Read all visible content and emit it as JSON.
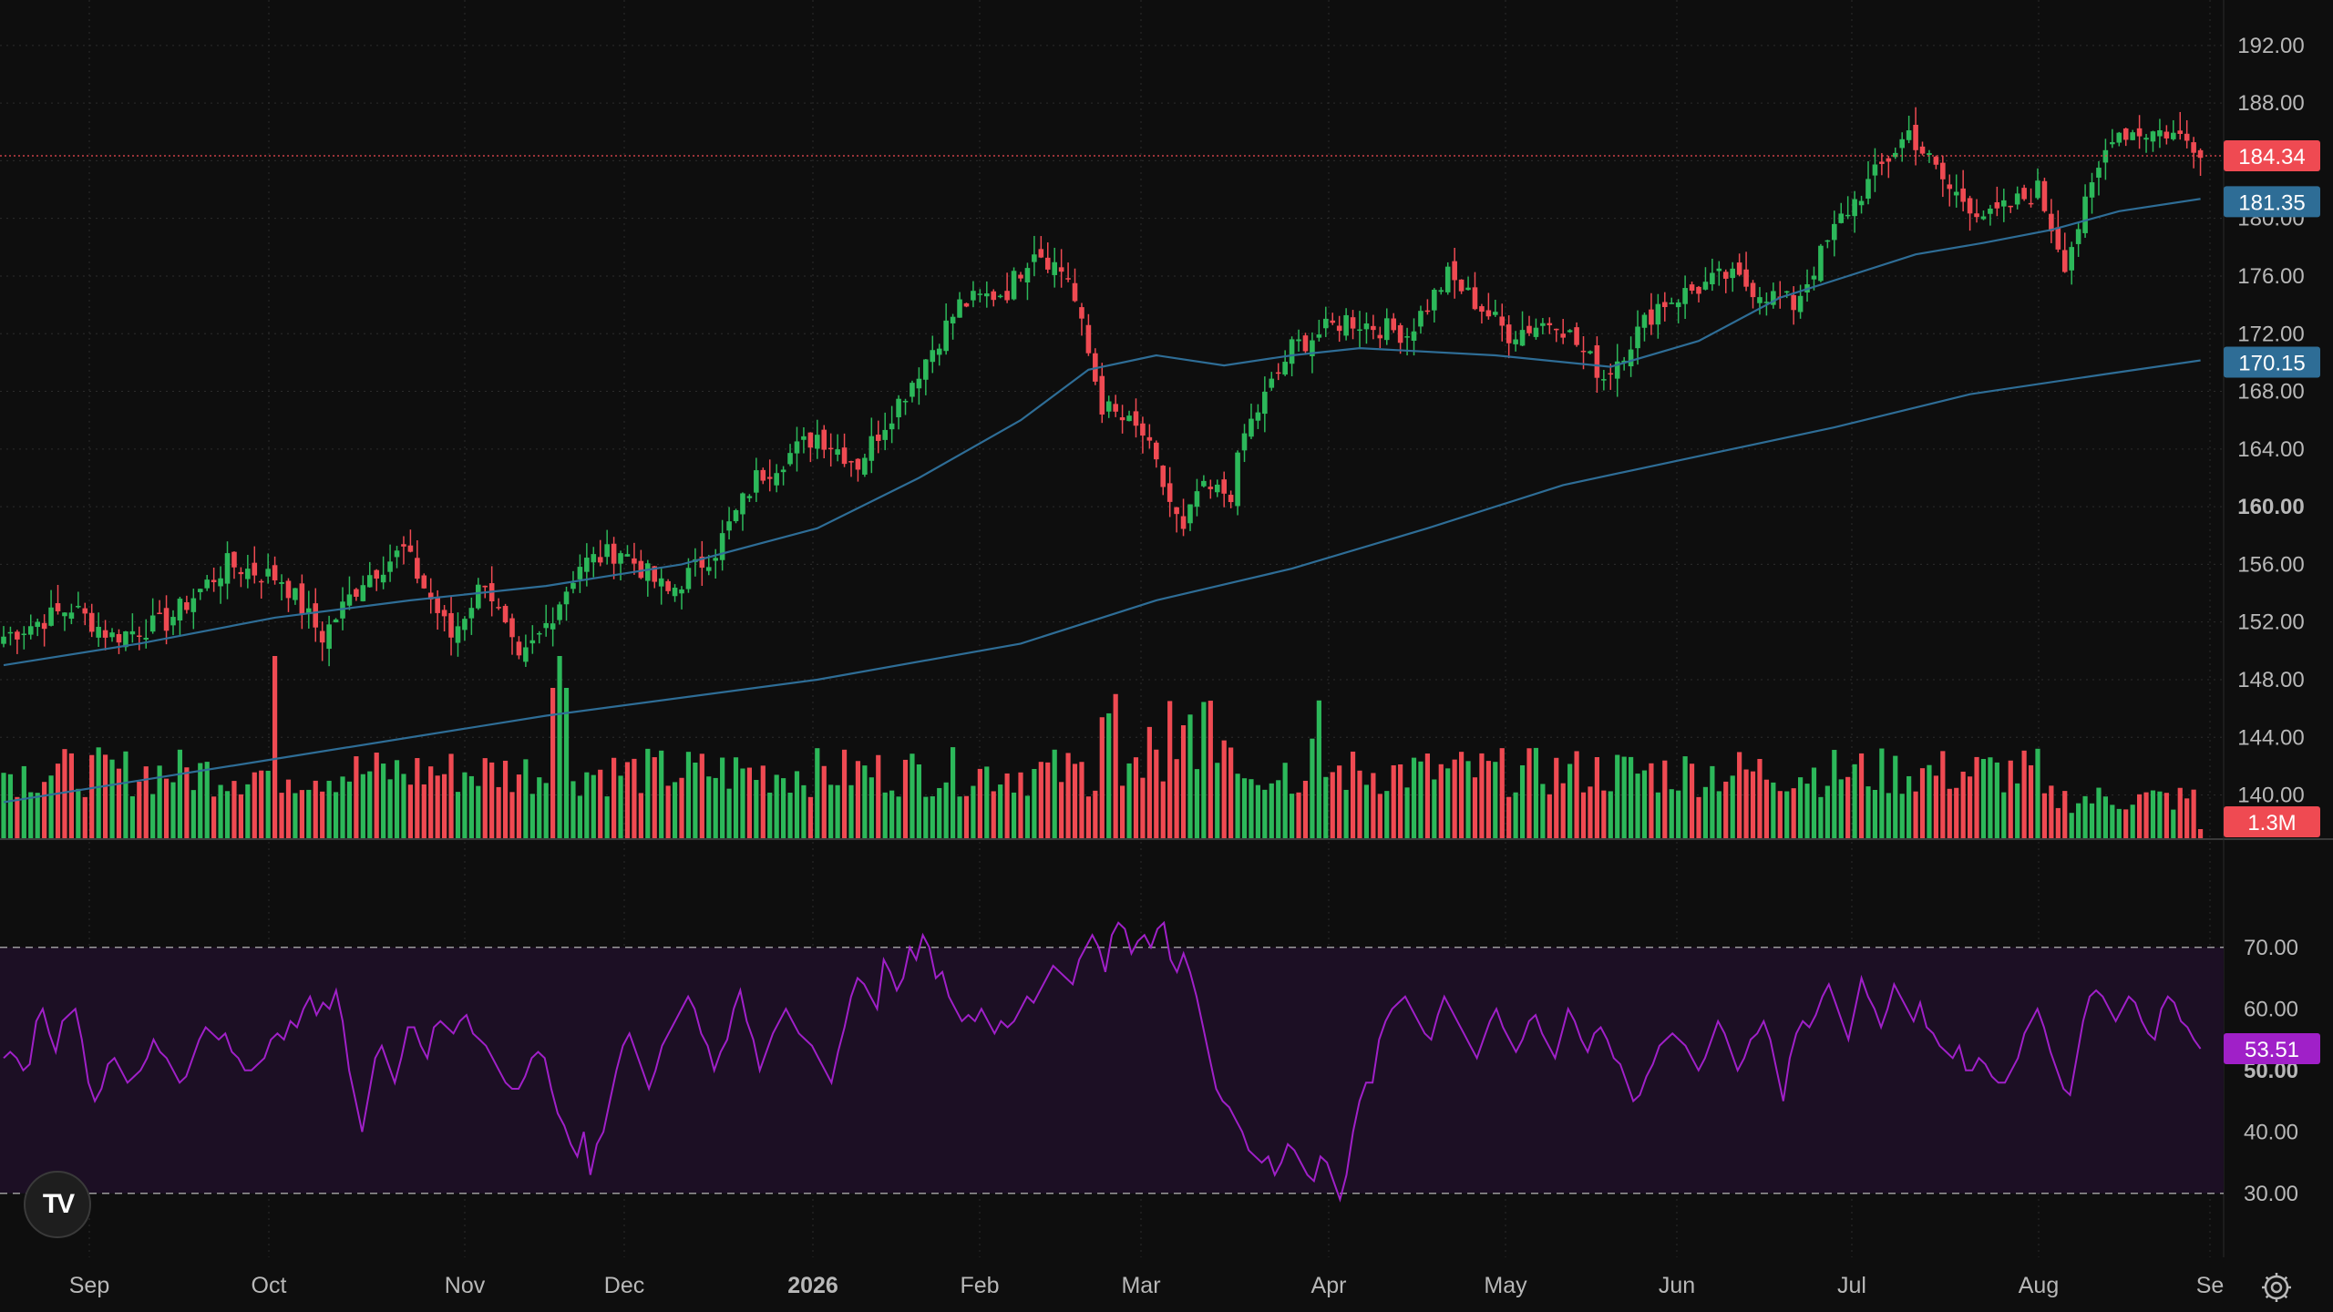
{
  "logo": {
    "text": "TV"
  },
  "colors": {
    "background": "#0e0e0e",
    "up": "#2cb85a",
    "down": "#ef4a52",
    "ma_fast": "#2e6d96",
    "ma_slow": "#2e6d96",
    "rsi": "#a020c8",
    "rsi_band": "#1c0f24",
    "grid": "#2c2c2c",
    "axis_text": "#b8b8b8"
  },
  "icons": {
    "settings": "gear-icon"
  },
  "chart_data": [
    {
      "type": "candlestick",
      "panel": "price",
      "ylim": [
        137,
        193
      ],
      "y_ticks": [
        "192.00",
        "188.00",
        "180.00",
        "176.00",
        "172.00",
        "168.00",
        "164.00",
        "160.00",
        "156.00",
        "152.00",
        "148.00",
        "144.00",
        "140.00"
      ],
      "x_ticks": [
        "Sep",
        "Oct",
        "Nov",
        "Dec",
        "2026",
        "Feb",
        "Mar",
        "Apr",
        "May",
        "Jun",
        "Jul",
        "Aug",
        "Se"
      ],
      "last_price_label": "184.34",
      "ma_labels": [
        "181.35",
        "170.15"
      ],
      "volume_label": "1.3M",
      "close_anchors": [
        [
          0,
          151
        ],
        [
          10,
          153
        ],
        [
          16,
          151
        ],
        [
          24,
          152
        ],
        [
          33,
          156
        ],
        [
          41,
          155
        ],
        [
          47,
          151
        ],
        [
          53,
          155
        ],
        [
          59,
          157
        ],
        [
          66,
          151
        ],
        [
          71,
          155
        ],
        [
          76,
          149
        ],
        [
          79,
          151
        ],
        [
          85,
          156
        ],
        [
          91,
          157
        ],
        [
          98,
          154
        ],
        [
          105,
          157
        ],
        [
          111,
          162
        ],
        [
          120,
          165
        ],
        [
          126,
          163
        ],
        [
          133,
          168
        ],
        [
          141,
          174
        ],
        [
          148,
          175
        ],
        [
          152,
          178
        ],
        [
          157,
          176
        ],
        [
          162,
          167
        ],
        [
          168,
          165
        ],
        [
          174,
          158
        ],
        [
          176,
          161
        ],
        [
          181,
          161
        ],
        [
          183,
          165
        ],
        [
          190,
          171
        ],
        [
          198,
          173
        ],
        [
          207,
          172
        ],
        [
          213,
          176
        ],
        [
          222,
          172
        ],
        [
          229,
          173
        ],
        [
          236,
          169
        ],
        [
          244,
          174
        ],
        [
          254,
          176
        ],
        [
          259,
          175
        ],
        [
          264,
          174
        ],
        [
          271,
          180
        ],
        [
          276,
          183
        ],
        [
          281,
          186
        ],
        [
          287,
          182
        ],
        [
          293,
          180
        ],
        [
          300,
          182
        ],
        [
          304,
          177
        ],
        [
          308,
          182
        ],
        [
          311,
          186
        ],
        [
          319,
          186
        ],
        [
          324,
          185
        ]
      ],
      "ma_fast": [
        [
          0,
          149
        ],
        [
          20,
          150.5
        ],
        [
          40,
          152.3
        ],
        [
          60,
          153.5
        ],
        [
          80,
          154.5
        ],
        [
          100,
          156
        ],
        [
          120,
          158.5
        ],
        [
          135,
          162
        ],
        [
          150,
          166
        ],
        [
          160,
          169.5
        ],
        [
          170,
          170.5
        ],
        [
          180,
          169.8
        ],
        [
          190,
          170.5
        ],
        [
          200,
          171
        ],
        [
          220,
          170.5
        ],
        [
          237,
          169.7
        ],
        [
          250,
          171.5
        ],
        [
          262,
          174.5
        ],
        [
          272,
          176
        ],
        [
          282,
          177.5
        ],
        [
          292,
          178.3
        ],
        [
          302,
          179.2
        ],
        [
          312,
          180.5
        ],
        [
          324,
          181.35
        ]
      ],
      "ma_slow": [
        [
          0,
          139.5
        ],
        [
          40,
          142.5
        ],
        [
          80,
          145.5
        ],
        [
          120,
          148
        ],
        [
          150,
          150.5
        ],
        [
          170,
          153.5
        ],
        [
          190,
          155.7
        ],
        [
          210,
          158.5
        ],
        [
          230,
          161.5
        ],
        [
          250,
          163.5
        ],
        [
          270,
          165.5
        ],
        [
          290,
          167.8
        ],
        [
          310,
          169.2
        ],
        [
          324,
          170.15
        ]
      ]
    },
    {
      "type": "bar",
      "panel": "volume",
      "series": [
        {
          "values_note": "daily volume bars colored by candle direction"
        }
      ]
    },
    {
      "type": "line",
      "panel": "rsi",
      "ylim": [
        27,
        75
      ],
      "y_ticks": [
        "70.00",
        "60.00",
        "50.00",
        "40.00",
        "30.00"
      ],
      "bands": [
        30,
        70
      ],
      "last_label": "53.51",
      "values": [
        52,
        53,
        52,
        50,
        51,
        58,
        60,
        56,
        53,
        58,
        59,
        60,
        55,
        48,
        45,
        47,
        51,
        52,
        50,
        48,
        49,
        50,
        52,
        55,
        53,
        52,
        50,
        48,
        49,
        52,
        55,
        57,
        56,
        55,
        56,
        53,
        52,
        50,
        50,
        51,
        52,
        55,
        56,
        55,
        58,
        57,
        60,
        62,
        59,
        61,
        60,
        63,
        58,
        50,
        45,
        40,
        46,
        52,
        54,
        51,
        48,
        52,
        57,
        57,
        54,
        52,
        57,
        58,
        57,
        56,
        58,
        59,
        56,
        55,
        54,
        52,
        50,
        48,
        47,
        47,
        49,
        52,
        53,
        52,
        47,
        43,
        41,
        38,
        36,
        40,
        33,
        38,
        40,
        45,
        50,
        54,
        56,
        53,
        50,
        47,
        50,
        54,
        56,
        58,
        60,
        62,
        60,
        56,
        54,
        50,
        53,
        55,
        60,
        63,
        58,
        55,
        50,
        53,
        56,
        58,
        60,
        58,
        56,
        55,
        54,
        52,
        50,
        48,
        53,
        57,
        62,
        65,
        64,
        62,
        60,
        68,
        66,
        63,
        65,
        70,
        68,
        72,
        70,
        65,
        66,
        62,
        60,
        58,
        59,
        58,
        60,
        58,
        56,
        58,
        57,
        58,
        60,
        62,
        61,
        63,
        65,
        67,
        66,
        65,
        64,
        68,
        70,
        72,
        70,
        66,
        72,
        74,
        73,
        69,
        71,
        72,
        70,
        73,
        74,
        68,
        66,
        69,
        66,
        62,
        57,
        52,
        47,
        45,
        44,
        42,
        40,
        37,
        36,
        35,
        36,
        33,
        35,
        38,
        37,
        35,
        33,
        32,
        36,
        35,
        32,
        29,
        33,
        40,
        45,
        48,
        48,
        55,
        58,
        60,
        61,
        62,
        60,
        58,
        56,
        55,
        59,
        62,
        60,
        58,
        56,
        54,
        52,
        55,
        58,
        60,
        57,
        55,
        53,
        55,
        58,
        59,
        56,
        54,
        52,
        56,
        60,
        58,
        55,
        53,
        56,
        57,
        55,
        52,
        51,
        48,
        45,
        46,
        49,
        51,
        54,
        55,
        56,
        55,
        54,
        52,
        50,
        52,
        55,
        58,
        56,
        53,
        50,
        52,
        55,
        56,
        58,
        55,
        50,
        45,
        52,
        56,
        58,
        57,
        59,
        62,
        64,
        61,
        58,
        55,
        60,
        65,
        62,
        60,
        57,
        60,
        64,
        62,
        60,
        58,
        61,
        57,
        56,
        54,
        53,
        52,
        54,
        50,
        50,
        52,
        51,
        49,
        48,
        48,
        50,
        52,
        56,
        58,
        60,
        57,
        53,
        50,
        47,
        46,
        52,
        58,
        62,
        63,
        62,
        60,
        58,
        60,
        62,
        61,
        58,
        56,
        55,
        60,
        62,
        61,
        58,
        57,
        55,
        53.51
      ]
    }
  ]
}
